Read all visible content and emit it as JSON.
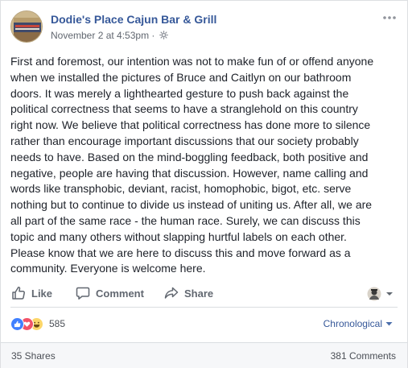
{
  "post": {
    "page_name": "Dodie's Place Cajun Bar & Grill",
    "timestamp": "November 2 at 4:53pm",
    "separator": "·",
    "privacy_icon": "globe-icon",
    "more_icon": "more-options-icon",
    "body": "First and foremost, our intention was not to make fun of or offend anyone\nwhen we installed the pictures of Bruce and Caitlyn on our bathroom\ndoors. It was merely a lighthearted gesture to push back against the\npolitical correctness that seems to have a stranglehold on this country\nright now. We believe that political correctness has done more to silence\nrather than encourage important discussions that our society probably\nneeds to have. Based on the mind-boggling feedback, both positive and\nnegative, people are having that discussion. However, name calling and\nwords like transphobic, deviant, racist, homophobic, bigot, etc. serve\nnothing but to continue to divide us instead of uniting us. After all, we are\nall part of the same race - the human race. Surely, we can discuss this\ntopic and many others without slapping hurtful labels on each other.\nPlease know that we are here to discuss this and move forward as a\ncommunity. Everyone is welcome here."
  },
  "actions": {
    "like_label": "Like",
    "comment_label": "Comment",
    "share_label": "Share"
  },
  "reactions": {
    "types": [
      "like",
      "love",
      "haha"
    ],
    "count": "585",
    "colors": {
      "like": "#4080ff",
      "love": "#f25268",
      "haha": "#fcd669"
    }
  },
  "sort": {
    "label": "Chronological"
  },
  "footer": {
    "shares": "35 Shares",
    "comments": "381 Comments"
  },
  "colors": {
    "link": "#365899",
    "text": "#1d2129",
    "muted": "#616770"
  }
}
